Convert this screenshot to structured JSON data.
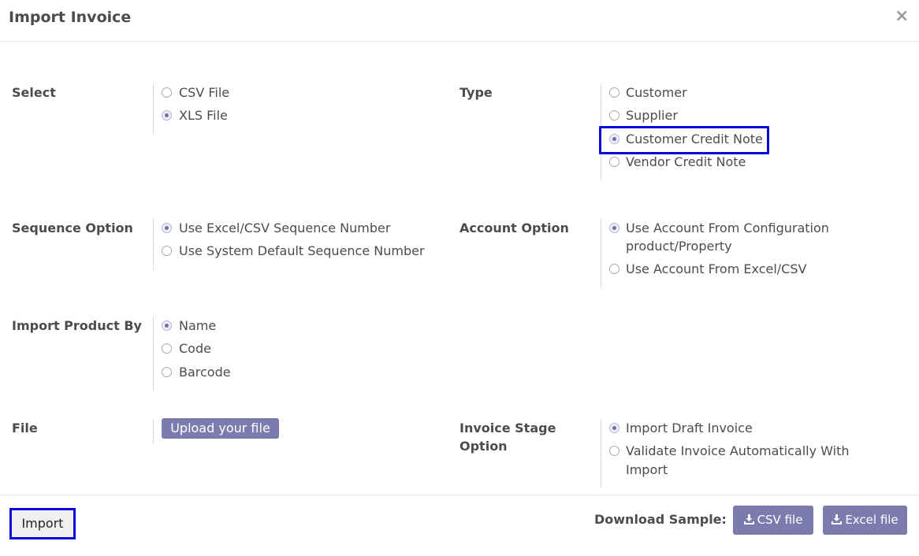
{
  "dialog": {
    "title": "Import Invoice",
    "close_glyph": "×"
  },
  "select": {
    "label": "Select",
    "options": [
      "CSV File",
      "XLS File"
    ],
    "selected": "XLS File"
  },
  "type": {
    "label": "Type",
    "options": [
      "Customer",
      "Supplier",
      "Customer Credit Note",
      "Vendor Credit Note"
    ],
    "selected": "Customer Credit Note"
  },
  "sequence": {
    "label": "Sequence Option",
    "options": [
      "Use Excel/CSV Sequence Number",
      "Use System Default Sequence Number"
    ],
    "selected": "Use Excel/CSV Sequence Number"
  },
  "account": {
    "label": "Account Option",
    "options": [
      "Use Account From Configuration",
      "product/Property",
      "Use Account From Excel/CSV"
    ],
    "selected": "Use Account From Configuration product/Property"
  },
  "product_by": {
    "label": "Import Product By",
    "options": [
      "Name",
      "Code",
      "Barcode"
    ],
    "selected": "Name"
  },
  "file": {
    "label": "File",
    "upload_label": "Upload your file"
  },
  "stage": {
    "label_line1": "Invoice Stage",
    "label_line2": "Option",
    "options": [
      "Import Draft Invoice",
      "Validate Invoice Automatically With",
      "Import"
    ],
    "selected": "Import Draft Invoice"
  },
  "footer": {
    "import_label": "Import",
    "download_label": "Download Sample:",
    "csv_label": "CSV file",
    "excel_label": "Excel file",
    "download_icon": "download-icon"
  },
  "colors": {
    "accent": "#7c7bad",
    "highlight": "#0a0ad8",
    "text": "#4c4c4c"
  }
}
